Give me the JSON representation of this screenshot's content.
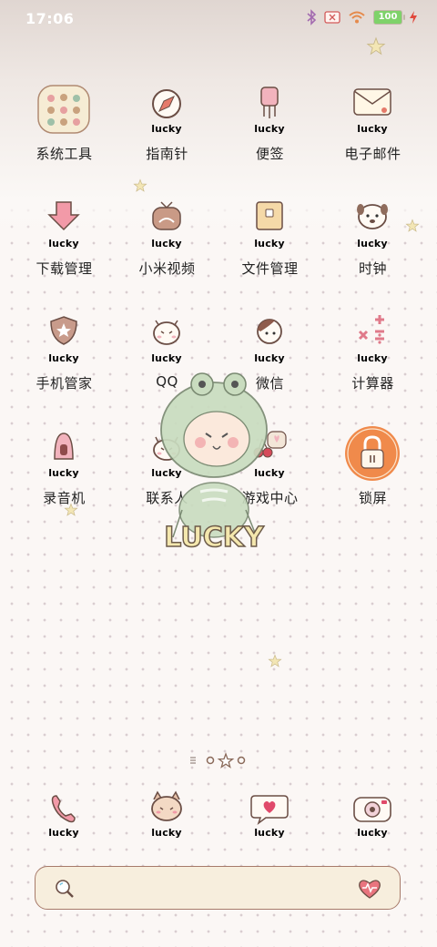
{
  "status_bar": {
    "time": "17:06",
    "battery": "100",
    "icons": [
      "bluetooth-icon",
      "no-sim-icon",
      "wifi-icon",
      "battery-icon",
      "charging-icon"
    ]
  },
  "apps": [
    {
      "name": "系统工具",
      "icon": "system-tools-folder-icon"
    },
    {
      "name": "指南针",
      "icon": "compass-icon"
    },
    {
      "name": "便签",
      "icon": "notes-icon"
    },
    {
      "name": "电子邮件",
      "icon": "email-icon"
    },
    {
      "name": "下载管理",
      "icon": "download-icon"
    },
    {
      "name": "小米视频",
      "icon": "tv-icon"
    },
    {
      "name": "文件管理",
      "icon": "file-manager-icon"
    },
    {
      "name": "时钟",
      "icon": "clock-pug-icon"
    },
    {
      "name": "手机管家",
      "icon": "security-shield-icon"
    },
    {
      "name": "QQ",
      "icon": "qq-cat-icon"
    },
    {
      "name": "微信",
      "icon": "wechat-face-icon"
    },
    {
      "name": "计算器",
      "icon": "calculator-icon"
    },
    {
      "name": "录音机",
      "icon": "recorder-mic-icon"
    },
    {
      "name": "联系人",
      "icon": "contacts-cat-icon"
    },
    {
      "name": "游戏中心",
      "icon": "game-center-cherry-icon"
    },
    {
      "name": "锁屏",
      "icon": "lock-screen-icon"
    }
  ],
  "icon_caption": "lucky",
  "mascot_caption": "LUCKY",
  "dock": [
    {
      "icon": "phone-icon"
    },
    {
      "icon": "messages-cat-icon"
    },
    {
      "icon": "chat-heart-icon"
    },
    {
      "icon": "camera-icon"
    }
  ],
  "search_bar": {
    "left_icon": "magnifier-icon",
    "right_icon": "heart-icon"
  },
  "colors": {
    "accent": "#f08a4b",
    "search_bg": "#f7eedd",
    "lucky_text": "#f5e3a5"
  }
}
